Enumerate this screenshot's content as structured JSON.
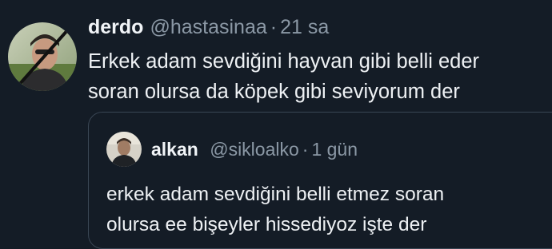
{
  "tweet": {
    "display_name": "derdo",
    "handle": "@hastasinaa",
    "separator": "·",
    "time": "21 sa",
    "text_lines": [
      "Erkek adam sevdiğini hayvan gibi belli eder",
      "soran olursa da köpek gibi seviyorum der"
    ]
  },
  "quoted_tweet": {
    "display_name": "alkan",
    "handle": "@sikloalko",
    "separator": "·",
    "time": "1 gün",
    "text_lines": [
      "erkek adam sevdiğini belli etmez soran",
      "olursa ee bişeyler hissediyoz işte der"
    ]
  },
  "colors": {
    "background": "#141c26",
    "primary_text": "#eef1f4",
    "secondary_text": "#8b98a5",
    "card_border": "#3a4654"
  }
}
